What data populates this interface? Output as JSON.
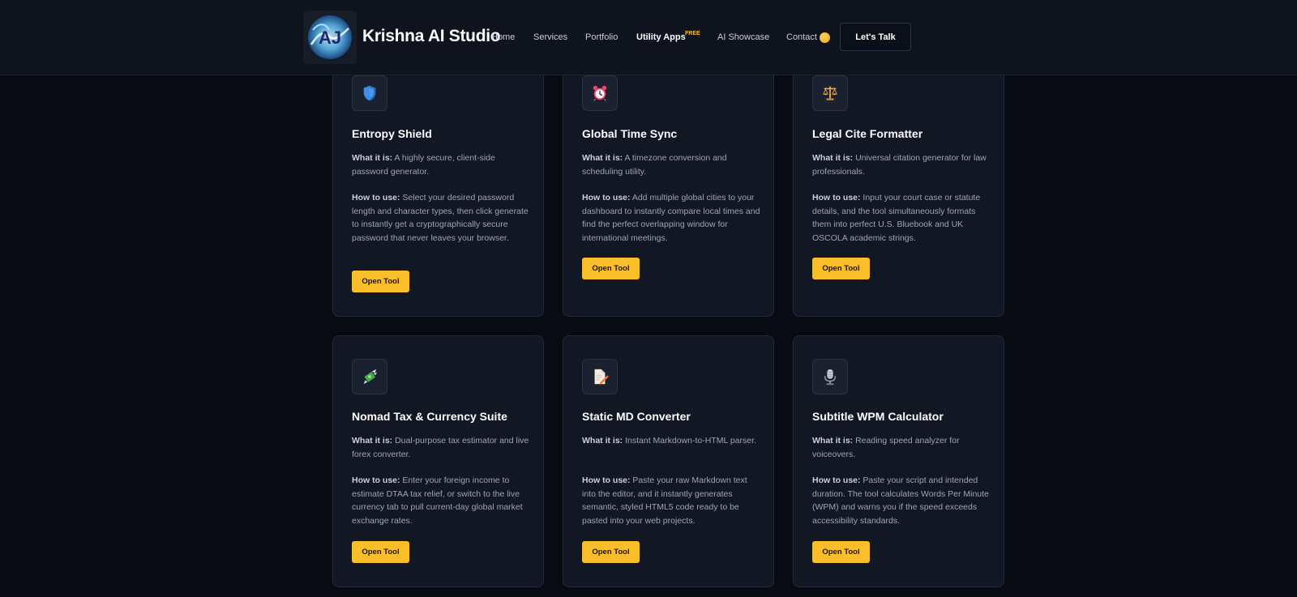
{
  "header": {
    "brand": "Krishna AI Studio",
    "logo_text": "AJ",
    "nav": [
      {
        "label": "Home"
      },
      {
        "label": "Services"
      },
      {
        "label": "Portfolio"
      },
      {
        "label": "Utility Apps",
        "badge": "FREE"
      },
      {
        "label": "AI Showcase"
      },
      {
        "label": "Contact"
      }
    ],
    "cta": "Let's Talk"
  },
  "colors": {
    "accent": "#f9bf2a",
    "background": "#080b12",
    "card": "#111723"
  },
  "cards": [
    {
      "icon": "shield-icon",
      "title": "Entropy Shield",
      "what_label": "What it is:",
      "what": "A highly secure, client-side password generator.",
      "how_label": "How to use:",
      "how": "Select your desired password length and character types, then click generate to instantly get a cryptographically secure password that never leaves your browser.",
      "button": "Open Tool"
    },
    {
      "icon": "alarm-clock-icon",
      "title": "Global Time Sync",
      "what_label": "What it is:",
      "what": "A timezone conversion and scheduling utility.",
      "how_label": "How to use:",
      "how": "Add multiple global cities to your dashboard to instantly compare local times and find the perfect overlapping window for international meetings.",
      "button": "Open Tool"
    },
    {
      "icon": "scales-icon",
      "title": "Legal Cite Formatter",
      "what_label": "What it is:",
      "what": "Universal citation generator for law professionals.",
      "how_label": "How to use:",
      "how": "Input your court case or statute details, and the tool simultaneously formats them into perfect U.S. Bluebook and UK OSCOLA academic strings.",
      "button": "Open Tool"
    },
    {
      "icon": "money-with-wings-icon",
      "title": "Nomad Tax & Currency Suite",
      "what_label": "What it is:",
      "what": "Dual-purpose tax estimator and live forex converter.",
      "how_label": "How to use:",
      "how": "Enter your foreign income to estimate DTAA tax relief, or switch to the live currency tab to pull current-day global market exchange rates.",
      "button": "Open Tool"
    },
    {
      "icon": "document-pencil-icon",
      "title": "Static MD Converter",
      "what_label": "What it is:",
      "what": "Instant Markdown-to-HTML parser.",
      "how_label": "How to use:",
      "how": "Paste your raw Markdown text into the editor, and it instantly generates semantic, styled HTML5 code ready to be pasted into your web projects.",
      "button": "Open Tool"
    },
    {
      "icon": "microphone-icon",
      "title": "Subtitle WPM Calculator",
      "what_label": "What it is:",
      "what": "Reading speed analyzer for voiceovers.",
      "how_label": "How to use:",
      "how": "Paste your script and intended duration. The tool calculates Words Per Minute (WPM) and warns you if the speed exceeds accessibility standards.",
      "button": "Open Tool"
    }
  ]
}
